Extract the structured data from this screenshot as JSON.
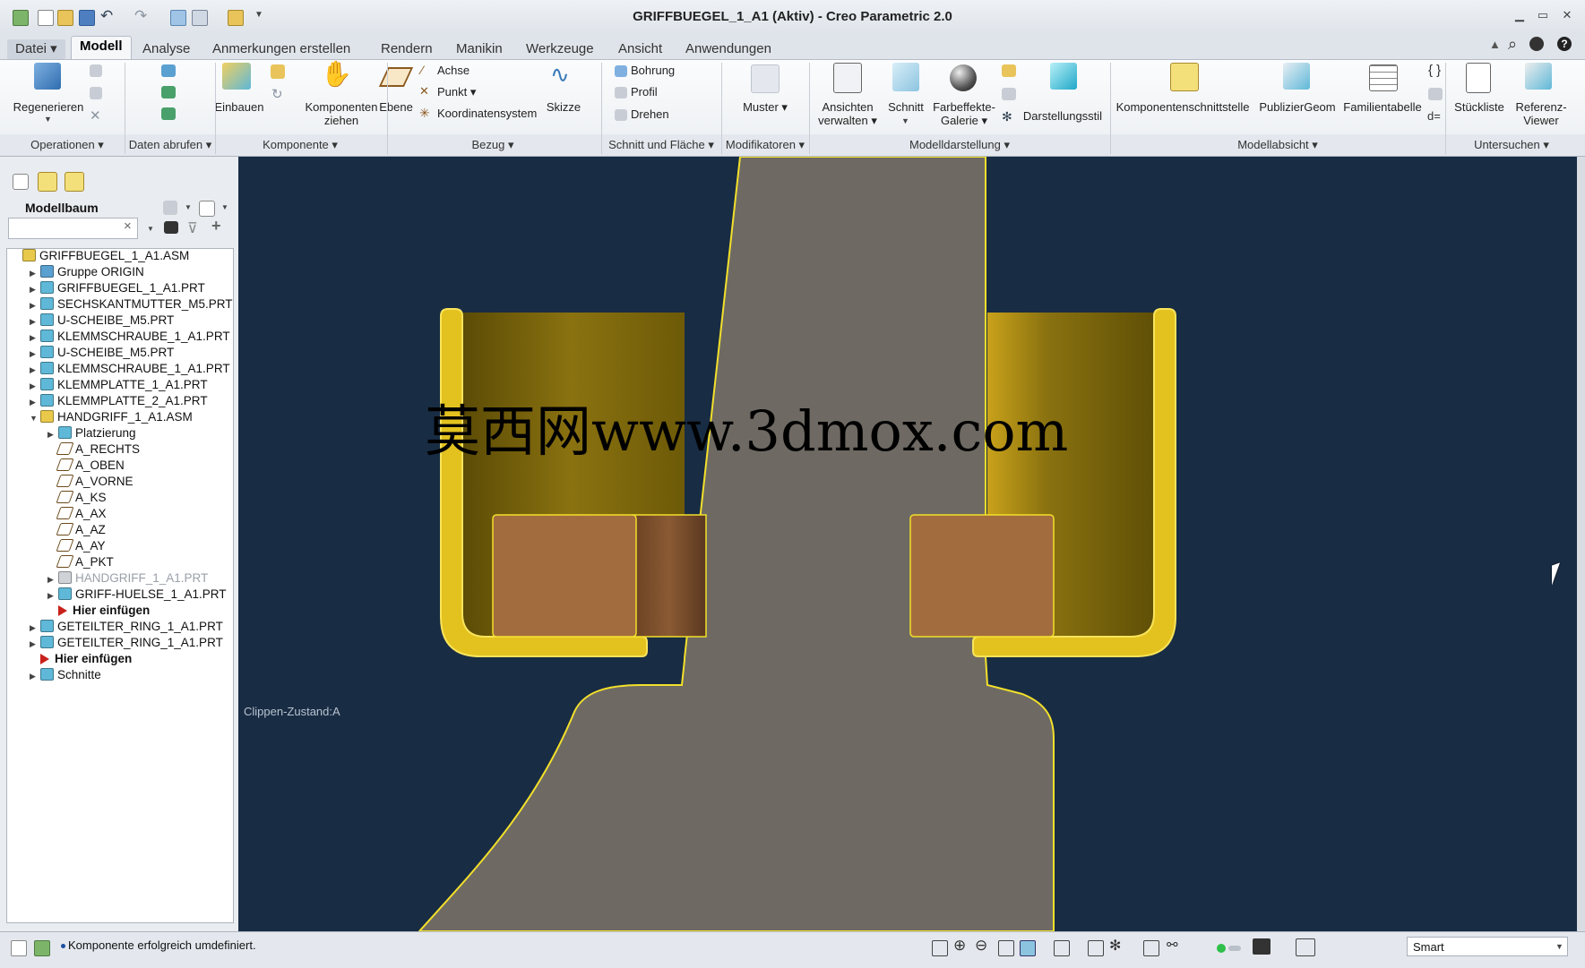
{
  "window": {
    "title": "GRIFFBUEGEL_1_A1 (Aktiv) - Creo Parametric 2.0",
    "minimize": "▁",
    "maximize": "▭",
    "close": "✕"
  },
  "menu": {
    "tabs": [
      "Datei ▾",
      "Modell",
      "Analyse",
      "Anmerkungen erstellen",
      "Rendern",
      "Manikin",
      "Werkzeuge",
      "Ansicht",
      "Anwendungen"
    ],
    "active": "Modell"
  },
  "ribbon": {
    "regenerieren": "Regenerieren",
    "einbauen": "Einbauen",
    "komponenten_ziehen_1": "Komponenten",
    "komponenten_ziehen_2": "ziehen",
    "ebene": "Ebene",
    "achse": "Achse",
    "punkt": "Punkt ▾",
    "koordinatensystem": "Koordinatensystem",
    "skizze": "Skizze",
    "bohrung": "Bohrung",
    "profil": "Profil",
    "drehen": "Drehen",
    "muster": "Muster ▾",
    "ansichten_1": "Ansichten",
    "ansichten_2": "verwalten ▾",
    "schnitt": "Schnitt",
    "farbeffekte_1": "Farbeffekte-",
    "farbeffekte_2": "Galerie ▾",
    "darstellungsstil": "Darstellungsstil",
    "komponentenschnittstelle": "Komponentenschnittstelle",
    "publiziergeom": "PublizierGeom",
    "familientabelle": "Familientabelle",
    "stueckliste": "Stückliste",
    "referenz_1": "Referenz-",
    "referenz_2": "Viewer",
    "groups": [
      "Operationen ▾",
      "Daten abrufen ▾",
      "Komponente ▾",
      "Bezug ▾",
      "Schnitt und Fläche ▾",
      "Modifikatoren ▾",
      "Modelldarstellung ▾",
      "Modellabsicht ▾",
      "Untersuchen ▾"
    ]
  },
  "panel": {
    "title": "Modellbaum",
    "search_value": "",
    "clear": "×"
  },
  "tree": [
    {
      "label": "GRIFFBUEGEL_1_A1.ASM",
      "indent": 0,
      "exp": "",
      "icon": "assembly-icon",
      "color": "#e9c94a"
    },
    {
      "label": "Gruppe ORIGIN",
      "indent": 1,
      "exp": "▶",
      "icon": "group-icon",
      "color": "#5aa0d0"
    },
    {
      "label": "GRIFFBUEGEL_1_A1.PRT",
      "indent": 1,
      "exp": "▶",
      "icon": "part-icon",
      "color": "#5fb8d8"
    },
    {
      "label": "SECHSKANTMUTTER_M5.PRT",
      "indent": 1,
      "exp": "▶",
      "icon": "part-icon",
      "color": "#5fb8d8"
    },
    {
      "label": "U-SCHEIBE_M5.PRT",
      "indent": 1,
      "exp": "▶",
      "icon": "part-icon",
      "color": "#5fb8d8"
    },
    {
      "label": "KLEMMSCHRAUBE_1_A1.PRT",
      "indent": 1,
      "exp": "▶",
      "icon": "part-icon",
      "color": "#5fb8d8"
    },
    {
      "label": "U-SCHEIBE_M5.PRT",
      "indent": 1,
      "exp": "▶",
      "icon": "part-icon",
      "color": "#5fb8d8"
    },
    {
      "label": "KLEMMSCHRAUBE_1_A1.PRT",
      "indent": 1,
      "exp": "▶",
      "icon": "part-icon",
      "color": "#5fb8d8"
    },
    {
      "label": "KLEMMPLATTE_1_A1.PRT",
      "indent": 1,
      "exp": "▶",
      "icon": "part-icon",
      "color": "#5fb8d8"
    },
    {
      "label": "KLEMMPLATTE_2_A1.PRT",
      "indent": 1,
      "exp": "▶",
      "icon": "part-icon",
      "color": "#5fb8d8"
    },
    {
      "label": "HANDGRIFF_1_A1.ASM",
      "indent": 1,
      "exp": "▼",
      "icon": "assembly-icon",
      "color": "#e9c94a"
    },
    {
      "label": "Platzierung",
      "indent": 2,
      "exp": "▶",
      "icon": "placement-icon",
      "color": "#5fb8d8"
    },
    {
      "label": "A_RECHTS",
      "indent": 2,
      "exp": "",
      "icon": "datum-plane-icon",
      "color": "none"
    },
    {
      "label": "A_OBEN",
      "indent": 2,
      "exp": "",
      "icon": "datum-plane-icon",
      "color": "none"
    },
    {
      "label": "A_VORNE",
      "indent": 2,
      "exp": "",
      "icon": "datum-plane-icon",
      "color": "none"
    },
    {
      "label": "A_KS",
      "indent": 2,
      "exp": "",
      "icon": "csys-icon",
      "color": "none"
    },
    {
      "label": "A_AX",
      "indent": 2,
      "exp": "",
      "icon": "axis-icon",
      "color": "none"
    },
    {
      "label": "A_AZ",
      "indent": 2,
      "exp": "",
      "icon": "axis-icon",
      "color": "none"
    },
    {
      "label": "A_AY",
      "indent": 2,
      "exp": "",
      "icon": "axis-icon",
      "color": "none"
    },
    {
      "label": "A_PKT",
      "indent": 2,
      "exp": "",
      "icon": "point-icon",
      "color": "none"
    },
    {
      "label": "HANDGRIFF_1_A1.PRT",
      "indent": 2,
      "exp": "▶",
      "icon": "part-icon",
      "color": "#cfd3d8",
      "muted": true
    },
    {
      "label": "GRIFF-HUELSE_1_A1.PRT",
      "indent": 2,
      "exp": "▶",
      "icon": "part-icon",
      "color": "#5fb8d8"
    },
    {
      "label": "Hier einfügen",
      "indent": 2,
      "exp": "",
      "icon": "insert-here-icon",
      "color": "none",
      "bold": true
    },
    {
      "label": "GETEILTER_RING_1_A1.PRT",
      "indent": 1,
      "exp": "▶",
      "icon": "part-icon",
      "color": "#5fb8d8"
    },
    {
      "label": "GETEILTER_RING_1_A1.PRT",
      "indent": 1,
      "exp": "▶",
      "icon": "part-icon",
      "color": "#5fb8d8"
    },
    {
      "label": "Hier einfügen",
      "indent": 1,
      "exp": "",
      "icon": "insert-here-icon",
      "color": "none",
      "bold": true
    },
    {
      "label": "Schnitte",
      "indent": 1,
      "exp": "▶",
      "icon": "sections-icon",
      "color": "#5fb8d8"
    }
  ],
  "viewport": {
    "clip_label": "Clippen-Zustand:A",
    "watermark": "莫西网www.3dmox.com"
  },
  "status": {
    "message": "Komponente erfolgreich umdefiniert.",
    "filter_value": "Smart"
  },
  "colors": {
    "background": "#182c44",
    "housing": "#e3c21f",
    "shaft": "#6e6a63",
    "pad": "#a36c3e"
  }
}
